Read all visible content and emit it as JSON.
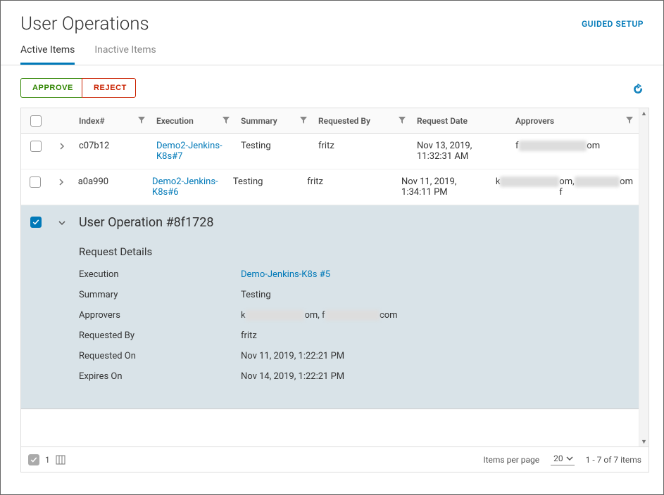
{
  "header": {
    "title": "User Operations",
    "guided_setup": "GUIDED SETUP"
  },
  "tabs": {
    "active": "Active Items",
    "inactive": "Inactive Items"
  },
  "actions": {
    "approve": "APPROVE",
    "reject": "REJECT"
  },
  "table": {
    "columns": {
      "index": "Index#",
      "execution": "Execution",
      "summary": "Summary",
      "requested_by": "Requested By",
      "request_date": "Request Date",
      "approvers": "Approvers"
    },
    "rows": [
      {
        "index": "c07b12",
        "execution": "Demo2-Jenkins-K8s#7",
        "summary": "Testing",
        "requested_by": "fritz",
        "request_date": "Nov 13, 2019, 11:32:31 AM",
        "approvers_prefix": "f",
        "approvers_suffix": "om"
      },
      {
        "index": "a0a990",
        "execution": "Demo2-Jenkins-K8s#6",
        "summary": "Testing",
        "requested_by": "fritz",
        "request_date": "Nov 11, 2019, 1:34:11 PM",
        "approvers_prefix": "k",
        "approvers_mid": "om, f",
        "approvers_suffix": "om"
      }
    ],
    "expanded": {
      "title": "User Operation #8f1728",
      "section": "Request Details",
      "fields": {
        "execution_k": "Execution",
        "execution_v": "Demo-Jenkins-K8s #5",
        "summary_k": "Summary",
        "summary_v": "Testing",
        "approvers_k": "Approvers",
        "approvers_prefix": "k",
        "approvers_mid": "om, f",
        "approvers_suffix": "com",
        "requested_by_k": "Requested By",
        "requested_by_v": "fritz",
        "requested_on_k": "Requested On",
        "requested_on_v": "Nov 11, 2019, 1:22:21 PM",
        "expires_on_k": "Expires On",
        "expires_on_v": "Nov 14, 2019, 1:22:21 PM"
      }
    }
  },
  "footer": {
    "selected_count": "1",
    "items_per_page_label": "Items per page",
    "items_per_page_value": "20",
    "range": "1 - 7 of 7 items"
  }
}
